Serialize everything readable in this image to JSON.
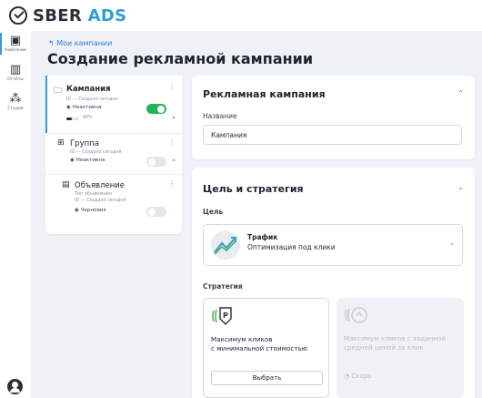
{
  "brand": {
    "name_main": "SBER",
    "name_accent": "ADS"
  },
  "sidebar": {
    "items": [
      {
        "label": "Кампании",
        "icon": "campaigns-icon",
        "glyph": "▣"
      },
      {
        "label": "Отчёты",
        "icon": "reports-icon",
        "glyph": "▥"
      },
      {
        "label": "Студия",
        "icon": "studio-icon",
        "glyph": "⁂"
      }
    ],
    "profile_icon": "profile-icon"
  },
  "header": {
    "back_label": "↰ Мои кампании",
    "title": "Создание рекламной кампании"
  },
  "tree": {
    "campaign": {
      "title": "Кампания",
      "meta": "ID ---   Создано сегодня",
      "status": "Неактивна",
      "progress_label": "40%",
      "progress": 0.4,
      "toggle_on": true
    },
    "group": {
      "title": "Группа",
      "meta": "ID ---   Создано сегодня",
      "status": "Неактивна",
      "toggle_on": false
    },
    "ad": {
      "title": "Объявление",
      "type": "Тип объявления",
      "meta": "ID ---   Создано сегодня",
      "status": "Черновик",
      "toggle_on": false
    }
  },
  "campaign_card": {
    "title": "Рекламная кампания",
    "name_label": "Название",
    "name_value": "Кампания"
  },
  "goal_card": {
    "title": "Цель и стратегия",
    "goal_label": "Цель",
    "goal": {
      "name": "Трафик",
      "description": "Оптимизация под клики"
    },
    "strategy_label": "Стратегия",
    "strategies": [
      {
        "text_line1": "Максимум кликов",
        "text_line2": "с минимальной стоимостью",
        "button": "Выбрать"
      },
      {
        "text_line1": "Максимум кликов с заданной",
        "text_line2": "средней ценой за клик",
        "soon": "Скоро"
      }
    ]
  },
  "colors": {
    "accent": "#2f9ed8",
    "toggle_on": "#22b45a",
    "link": "#2f7fd8"
  }
}
